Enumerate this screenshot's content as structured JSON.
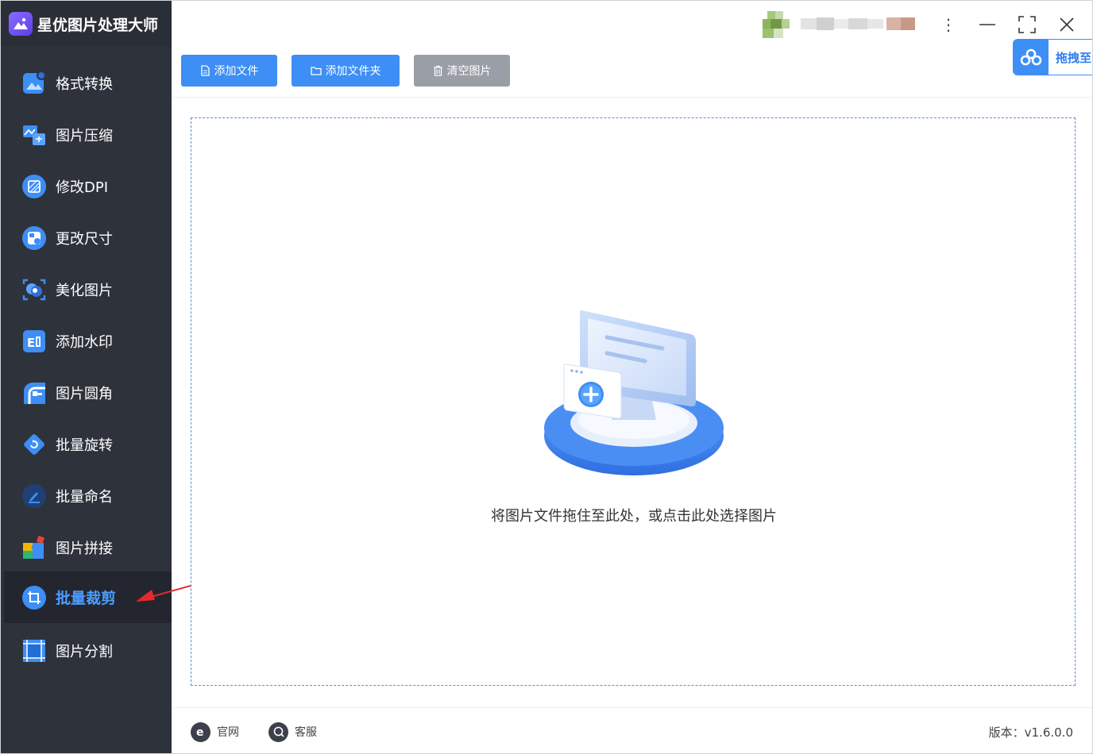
{
  "app": {
    "title": "星优图片处理大师",
    "accent_color": "#3d8ef5"
  },
  "sidebar": {
    "items": [
      {
        "label": "格式转换",
        "icon": "format-convert-icon",
        "active": false
      },
      {
        "label": "图片压缩",
        "icon": "image-compress-icon",
        "active": false
      },
      {
        "label": "修改DPI",
        "icon": "dpi-icon",
        "active": false
      },
      {
        "label": "更改尺寸",
        "icon": "resize-icon",
        "active": false
      },
      {
        "label": "美化图片",
        "icon": "beautify-icon",
        "active": false
      },
      {
        "label": "添加水印",
        "icon": "watermark-icon",
        "active": false
      },
      {
        "label": "图片圆角",
        "icon": "rounded-corner-icon",
        "active": false
      },
      {
        "label": "批量旋转",
        "icon": "rotate-icon",
        "active": false
      },
      {
        "label": "批量命名",
        "icon": "rename-icon",
        "active": false
      },
      {
        "label": "图片拼接",
        "icon": "puzzle-icon",
        "active": false
      },
      {
        "label": "批量裁剪",
        "icon": "crop-icon",
        "active": true
      },
      {
        "label": "图片分割",
        "icon": "split-icon",
        "active": false
      }
    ]
  },
  "toolbar": {
    "add_file": "添加文件",
    "add_folder": "添加文件夹",
    "clear": "清空图片",
    "drag_to": "拖拽至"
  },
  "dropzone": {
    "hint": "将图片文件拖住至此处，或点击此处选择图片"
  },
  "footer": {
    "website": "官网",
    "service": "客服",
    "version": "版本：v1.6.0.0"
  }
}
